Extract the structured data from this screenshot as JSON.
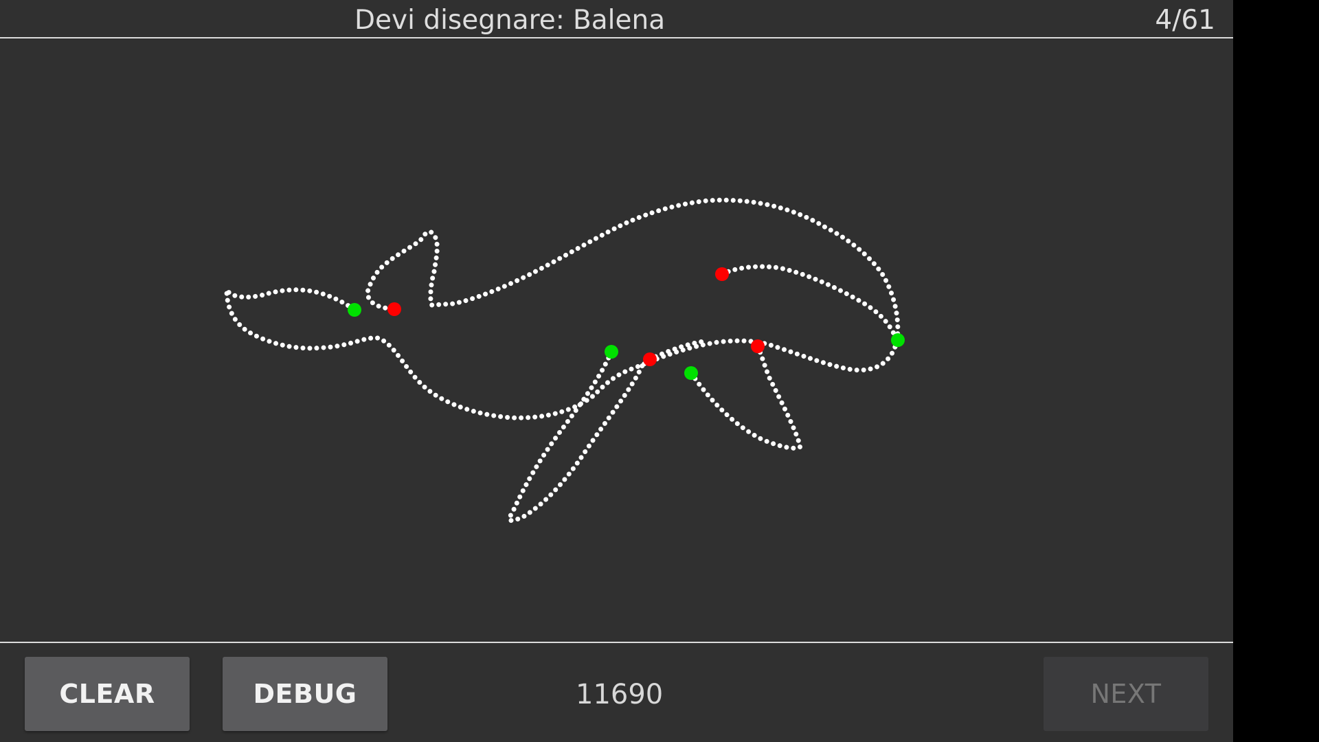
{
  "header": {
    "prompt_label": "Devi disegnare:",
    "target_word": "Balena",
    "progress": "4/61"
  },
  "footer": {
    "clear_label": "CLEAR",
    "debug_label": "DEBUG",
    "score": "11690",
    "next_label": "NEXT"
  },
  "colors": {
    "background": "#303030",
    "stroke": "#ffffff",
    "stroke_start": "#00e000",
    "stroke_end": "#ff0000"
  }
}
